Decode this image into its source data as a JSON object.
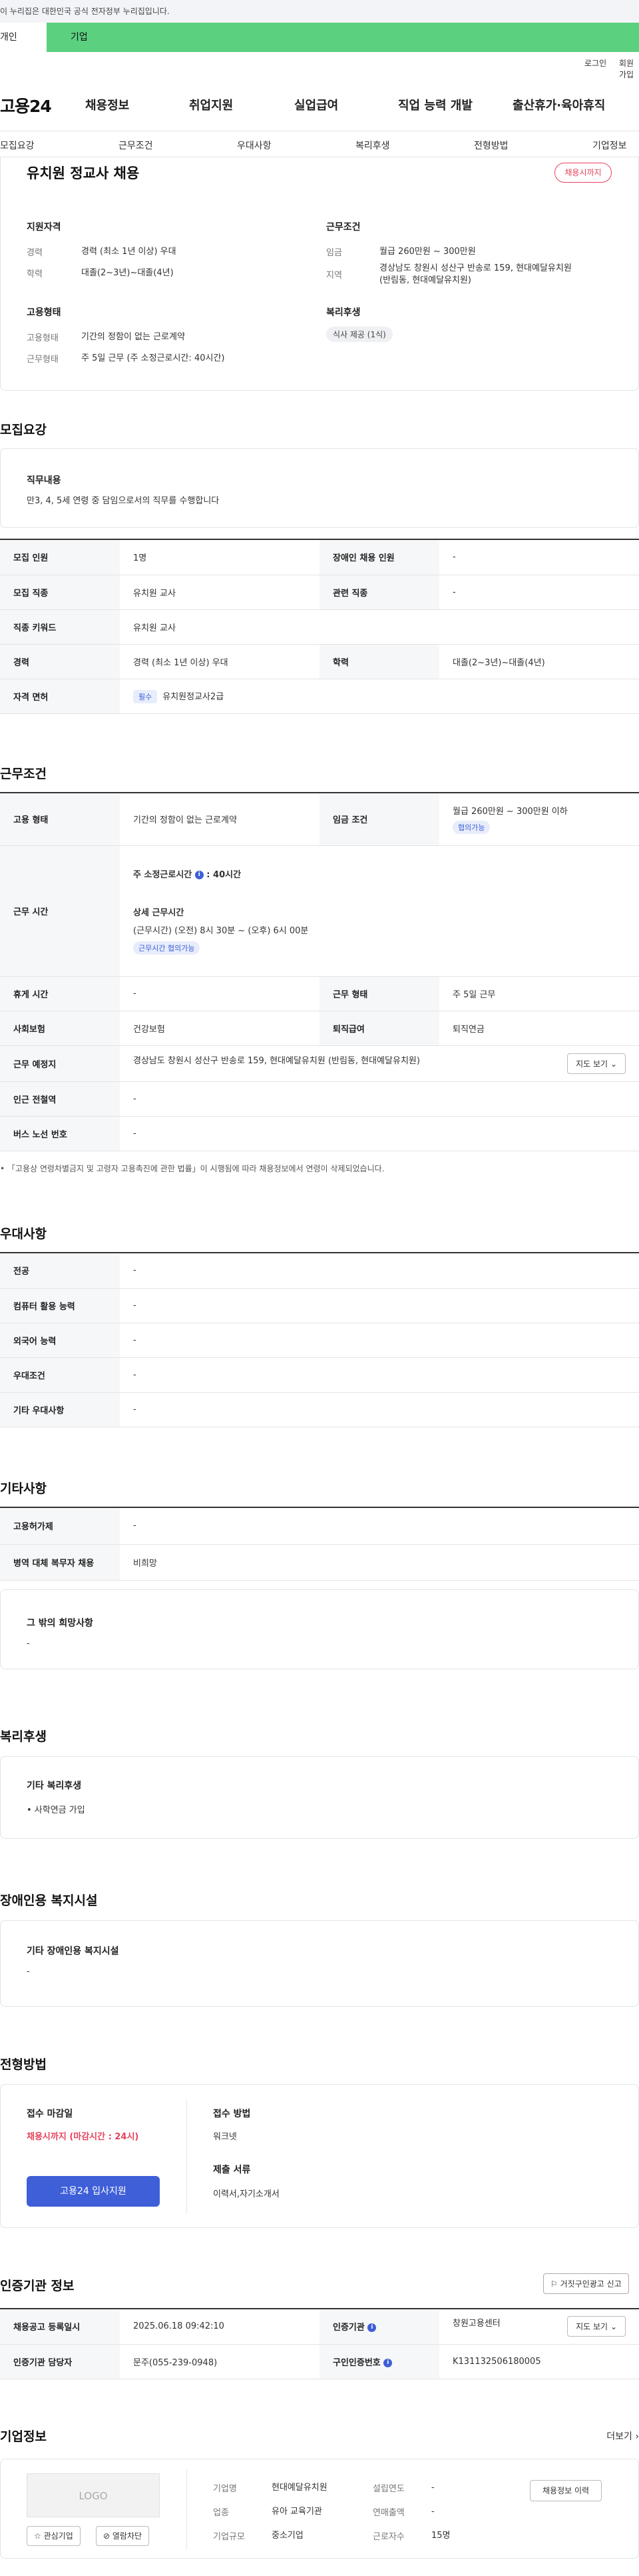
{
  "gov_notice": "이 누리집은 대한민국 공식 전자정부 누리집입니다.",
  "tabs": {
    "individual": "개인",
    "corporate": "기업"
  },
  "util": {
    "login": "로그인",
    "signup": "회원가입"
  },
  "logo": "고용24",
  "gnb": [
    "채용정보",
    "취업지원",
    "실업급여",
    "직업 능력 개발",
    "출산휴가·육아휴직"
  ],
  "subnav": [
    "모집요강",
    "근무조건",
    "우대사항",
    "복리후생",
    "전형방법",
    "기업정보"
  ],
  "job": {
    "title": "유치원 정교사 채용",
    "status": "채용시까지",
    "summary": {
      "qual_title": "지원자격",
      "career_k": "경력",
      "career_v": "경력 (최소 1년 이상) 우대",
      "edu_k": "학력",
      "edu_v": "대졸(2~3년)~대졸(4년)",
      "emp_title": "고용형태",
      "emptype_k": "고용형태",
      "emptype_v": "기간의 정함이 없는 근로계약",
      "worktype_k": "근무형태",
      "worktype_v": "주 5일 근무 (주 소정근로시간: 40시간)",
      "cond_title": "근무조건",
      "wage_k": "임금",
      "wage_v": "월급 260만원 ~ 300만원",
      "loc_k": "지역",
      "loc_v1": "경상남도 창원시 성산구 반송로 159, 현대예달유치원",
      "loc_v2": "(반림동, 현대예달유치원)",
      "welfare_title": "복리후생",
      "welfare_chip": "식사 제공 (1식)"
    }
  },
  "recruit": {
    "title": "모집요강",
    "duty_title": "직무내용",
    "duty_text": "만3, 4, 5세 연령 중 담임으로서의 직무를 수행합니다",
    "rows": {
      "count_k": "모집 인원",
      "count_v": "1명",
      "disabled_k": "장애인 채용 인원",
      "disabled_v": "-",
      "job_k": "모집 직종",
      "job_v": "유치원 교사",
      "rel_k": "관련 직종",
      "rel_v": "-",
      "kw_k": "직종 키워드",
      "kw_v": "유치원 교사",
      "career_k": "경력",
      "career_v": "경력 (최소 1년 이상) 우대",
      "edu_k": "학력",
      "edu_v": "대졸(2~3년)~대졸(4년)",
      "lic_k": "자격 면허",
      "lic_tag": "필수",
      "lic_v": "유치원정교사2급"
    }
  },
  "conditions": {
    "title": "근무조건",
    "emp_k": "고용 형태",
    "emp_v": "기간의 정함이 없는 근로계약",
    "wage_k": "임금 조건",
    "wage_v": "월급 260만원 ~ 300만원 이하",
    "wage_tag": "협의가능",
    "hours_k": "근무 시간",
    "hours_weekly_label": "주 소정근로시간",
    "hours_weekly_v": "40시간",
    "hours_detail_title": "상세 근무시간",
    "hours_detail_v": "(근무시간) (오전) 8시 30분 ~ (오후) 6시 00분",
    "hours_tag": "근무시간 협의가능",
    "rest_k": "휴게 시간",
    "rest_v": "-",
    "worktype_k": "근무 형태",
    "worktype_v": "주 5일 근무",
    "insurance_k": "사회보험",
    "insurance_v": "건강보험",
    "retire_k": "퇴직급여",
    "retire_v": "퇴직연금",
    "place_k": "근무 예정지",
    "place_v": "경상남도 창원시 성산구 반송로 159, 현대예달유치원 (반림동, 현대예달유치원)",
    "map_btn": "지도 보기",
    "subway_k": "인근 전철역",
    "subway_v": "-",
    "bus_k": "버스 노선 번호",
    "bus_v": "-",
    "note": "「고용상 연령차별금지 및 고령자 고용촉진에 관한 법률」이 시행됨에 따라 채용정보에서 연령이 삭제되었습니다."
  },
  "preference": {
    "title": "우대사항",
    "major_k": "전공",
    "major_v": "-",
    "pc_k": "컴퓨터 활용 능력",
    "pc_v": "-",
    "lang_k": "외국어 능력",
    "lang_v": "-",
    "cond_k": "우대조건",
    "cond_v": "-",
    "etc_k": "기타 우대사항",
    "etc_v": "-"
  },
  "other": {
    "title": "기타사항",
    "cnt_k": "고용허가제",
    "cnt_v": "-",
    "mil_k": "병역 대체 복무자 채용",
    "mil_v": "비희망",
    "wish_title": "그 밖의 희망사항",
    "wish_v": "-"
  },
  "welfare": {
    "title": "복리후생",
    "card_title": "기타 복리후생",
    "card_v": "• 사학연금 가입"
  },
  "disability": {
    "title": "장애인용 복지시설",
    "card_title": "기타 장애인용 복지시설",
    "card_v": "-"
  },
  "selection": {
    "title": "전형방법",
    "deadline_title": "접수 마감일",
    "deadline_v": "채용시까지 (마감시간 : 24시)",
    "apply_btn": "고용24 입사지원",
    "method_title": "접수 방법",
    "method_v": "워크넷",
    "docs_title": "제출 서류",
    "docs_v": "이력서,자기소개서"
  },
  "agency": {
    "title": "인증기관 정보",
    "report_btn": "거짓구인광고 신고",
    "date_k": "채용공고 등록일시",
    "date_v": "2025.06.18 09:42:10",
    "org_k": "인증기관",
    "org_v": "창원고용센터",
    "map_btn": "지도 보기",
    "mgr_k": "인증기관 담당자",
    "mgr_v": "문주(055-239-0948)",
    "num_k": "구인인증번호",
    "num_v": "K131132506180005"
  },
  "company": {
    "title": "기업정보",
    "more": "더보기",
    "logo": "LOGO",
    "fav_btn": "관심기업",
    "block_btn": "열람차단",
    "name_k": "기업명",
    "name_v": "현대예달유치원",
    "year_k": "설립연도",
    "year_v": "-",
    "ind_k": "업종",
    "ind_v": "유아 교육기관",
    "sales_k": "연매출액",
    "sales_v": "-",
    "size_k": "기업규모",
    "size_v": "중소기업",
    "emp_k": "근로자수",
    "emp_v": "15명",
    "history_btn": "채용정보 이력"
  }
}
